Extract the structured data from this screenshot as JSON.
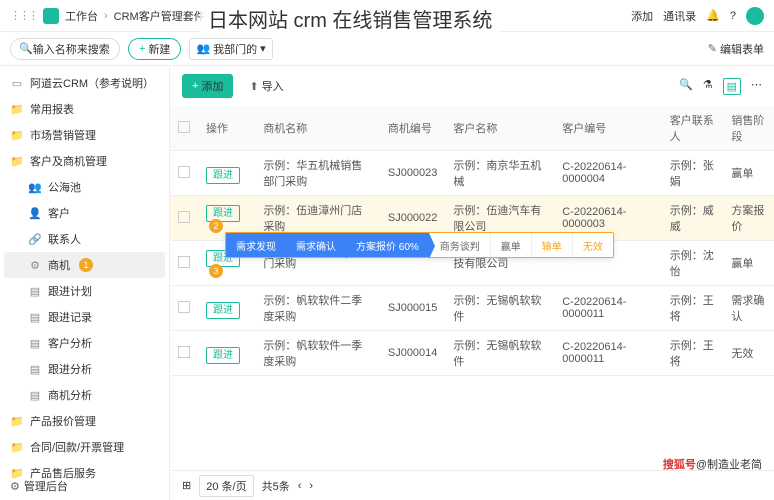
{
  "top": {
    "workspace": "工作台",
    "suite": "CRM客户管理套件",
    "add": "添加",
    "contacts": "通讯录"
  },
  "overlay": "日本网站 crm 在线销售管理系统",
  "search_ph": "输入名称来搜索",
  "btn_new": "新建",
  "dept": "我部门的",
  "edit_sheet": "编辑表单",
  "sidebar": [
    {
      "icon": "▭",
      "label": "阿道云CRM（参考说明）",
      "lv": 1
    },
    {
      "icon": "📁",
      "label": "常用报表",
      "lv": 1
    },
    {
      "icon": "📁",
      "label": "市场营销管理",
      "lv": 1
    },
    {
      "icon": "📁",
      "label": "客户及商机管理",
      "lv": 1
    },
    {
      "icon": "👥",
      "label": "公海池",
      "lv": 2
    },
    {
      "icon": "👤",
      "label": "客户",
      "lv": 2
    },
    {
      "icon": "🔗",
      "label": "联系人",
      "lv": 2
    },
    {
      "icon": "⚙",
      "label": "商机",
      "lv": 2,
      "active": true,
      "badge": "1"
    },
    {
      "icon": "▤",
      "label": "跟进计划",
      "lv": 2
    },
    {
      "icon": "▤",
      "label": "跟进记录",
      "lv": 2
    },
    {
      "icon": "▤",
      "label": "客户分析",
      "lv": 2
    },
    {
      "icon": "▤",
      "label": "跟进分析",
      "lv": 2
    },
    {
      "icon": "▤",
      "label": "商机分析",
      "lv": 2
    },
    {
      "icon": "📁",
      "label": "产品报价管理",
      "lv": 1
    },
    {
      "icon": "📁",
      "label": "合同/回款/开票管理",
      "lv": 1
    },
    {
      "icon": "📁",
      "label": "产品售后服务",
      "lv": 1
    }
  ],
  "admin": "管理后台",
  "toolbar": {
    "add": "添加",
    "import": "导入"
  },
  "cols": [
    "操作",
    "商机名称",
    "商机编号",
    "客户名称",
    "客户编号",
    "客户联系人",
    "销售阶段"
  ],
  "act": "跟进",
  "rows": [
    {
      "name": "示例：华五机械销售部门采购",
      "code": "SJ000023",
      "cust": "示例：南京华五机械",
      "ccode": "C-20220614-0000004",
      "contact": "示例：张娟",
      "stage": "赢单"
    },
    {
      "name": "示例：伍迪漳州门店采购",
      "code": "SJ000022",
      "cust": "示例：伍迪汽车有限公司",
      "ccode": "C-20220614-0000003",
      "contact": "示例：威威",
      "stage": "方案报价",
      "hl": true,
      "badge": "2"
    },
    {
      "name": "门采购",
      "code": "",
      "cust": "技有限公司",
      "ccode": "",
      "contact": "示例：沈怡",
      "stage": "赢单",
      "badge": "3"
    },
    {
      "name": "示例：帆软软件二季度采购",
      "code": "SJ000015",
      "cust": "示例：无锡帆软软件",
      "ccode": "C-20220614-0000011",
      "contact": "示例：王将",
      "stage": "需求确认"
    },
    {
      "name": "示例：帆软软件一季度采购",
      "code": "SJ000014",
      "cust": "示例：无锡帆软软件",
      "ccode": "C-20220614-0000011",
      "contact": "示例：王将",
      "stage": "无效"
    }
  ],
  "pipeline": [
    "需求发现",
    "需求确认",
    "方案报价 60%",
    "商务谈判",
    "赢单",
    "输单",
    "无效"
  ],
  "footer": {
    "per": "20 条/页",
    "total": "共5条"
  },
  "wm": {
    "a": "搜狐号",
    "b": "@制造业老简"
  }
}
